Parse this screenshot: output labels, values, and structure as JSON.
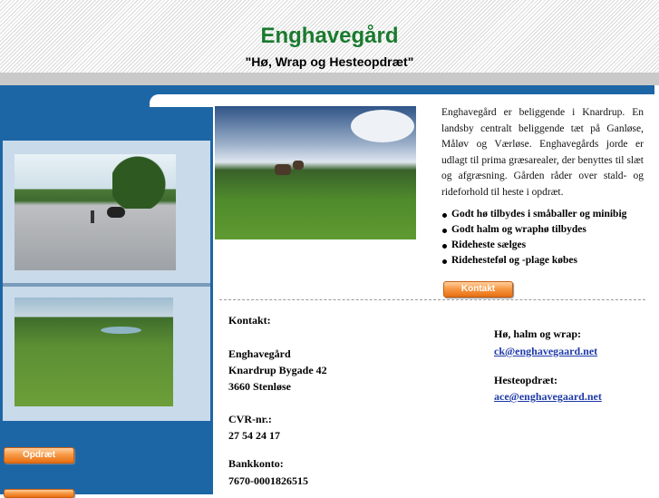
{
  "header": {
    "title": "Enghavegård",
    "subtitle": "\"Hø, Wrap og Hesteopdræt\""
  },
  "intro_text": "Enghavegård er beliggende i Knardrup. En landsby centralt beliggende tæt på Ganløse, Måløv og Værløse. Enghavegårds jorde er udlagt til prima græsarealer, der benyttes til slæt og afgræsning. Gården råder over stald- og rideforhold til heste i opdræt.",
  "features": [
    "Godt hø tilbydes i småballer og minibig",
    "Godt halm og wraphø tilbydes",
    "Rideheste sælges",
    "Ridehesteføl og -plage købes"
  ],
  "buttons": {
    "kontakt": "Kontakt",
    "opdraet": "Opdræt"
  },
  "contact": {
    "heading": "Kontakt:",
    "name": "Enghavegård",
    "street": "Knardrup Bygade 42",
    "city": "3660 Stenløse",
    "cvr_label": "CVR-nr.:",
    "cvr_value": "27 54 24 17",
    "bank_label": "Bankkonto:",
    "bank_value": "7670-0001826515"
  },
  "emails": {
    "hay_label": "Hø, halm og wrap:",
    "hay_email": "ck@enghavegaard.net",
    "breeding_label": "Hesteopdræt:",
    "breeding_email": "ace@enghavegaard.net"
  },
  "colors": {
    "title_green": "#1a7a2e",
    "sidebar_blue": "#1d66a6",
    "panel_light_blue": "#c9daea",
    "button_orange": "#f79a46",
    "link_blue": "#1f3aa8"
  }
}
